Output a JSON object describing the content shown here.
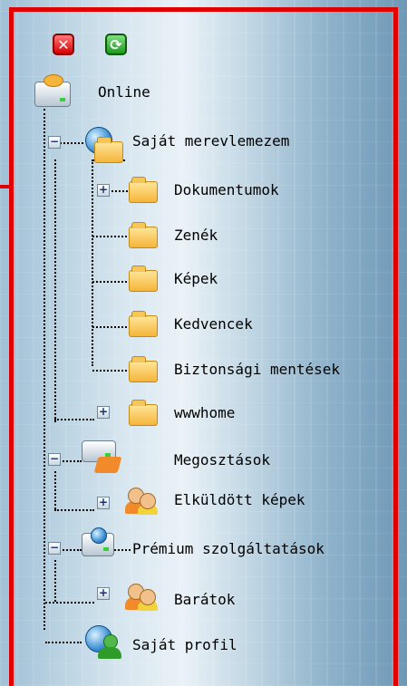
{
  "toolbar": {
    "close_icon": "close-icon",
    "refresh_icon": "refresh-icon"
  },
  "tree": {
    "root": {
      "label": "Online",
      "icon": "network-drive-icon"
    },
    "my_drive": {
      "label": "Saját merevlemezem",
      "icon": "globe-folder-icon"
    },
    "folders": [
      {
        "label": "Dokumentumok",
        "expandable": true
      },
      {
        "label": "Zenék",
        "expandable": false
      },
      {
        "label": "Képek",
        "expandable": false
      },
      {
        "label": "Kedvencek",
        "expandable": false
      },
      {
        "label": "Biztonsági mentések",
        "expandable": false
      },
      {
        "label": "wwwhome",
        "expandable": true
      }
    ],
    "shares": {
      "label": "Megosztások",
      "icon": "share-drive-icon"
    },
    "sent_images": {
      "label": "Elküldött képek",
      "icon": "people-icon"
    },
    "premium": {
      "label": "Prémium szolgáltatások",
      "icon": "premium-drive-icon"
    },
    "friends": {
      "label": "Barátok",
      "icon": "people-icon"
    },
    "profile": {
      "label": "Saját profil",
      "icon": "profile-icon"
    }
  },
  "colors": {
    "frame": "#e00000",
    "folder": "#f5b53a"
  }
}
